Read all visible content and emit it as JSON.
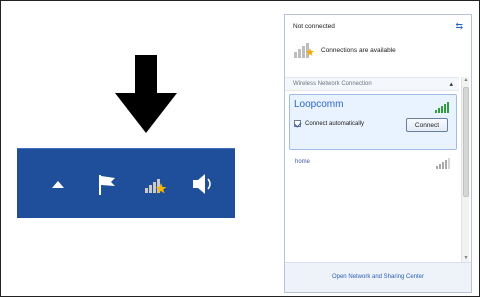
{
  "taskbar": {
    "icons": [
      "show-hidden-icons-icon",
      "action-center-flag-icon",
      "wireless-network-icon",
      "speaker-icon"
    ],
    "background": "#1f4f9a"
  },
  "flyout": {
    "status": "Not connected",
    "connections_available": "Connections are available",
    "section_header": "Wireless Network Connection",
    "selected_network": {
      "name": "Loopcomm",
      "connect_auto_label": "Connect automatically",
      "connect_auto_checked": true,
      "connect_button": "Connect"
    },
    "other_network": {
      "name": "home"
    },
    "footer_link": "Open Network and Sharing Center"
  }
}
